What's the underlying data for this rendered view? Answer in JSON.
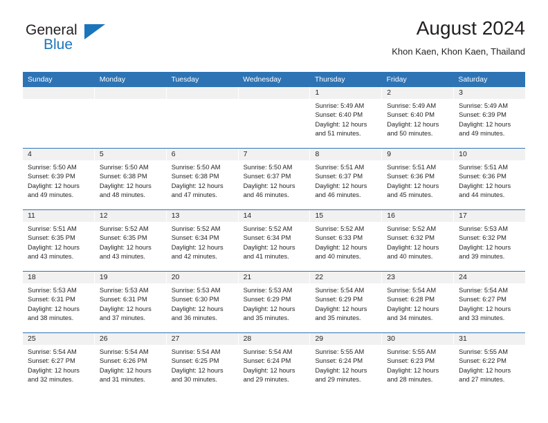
{
  "brand": {
    "line1": "General",
    "line2": "Blue",
    "triangle_icon": "triangle-icon",
    "color_dark": "#231f20",
    "color_blue": "#1b75bb"
  },
  "header": {
    "title": "August 2024",
    "subtitle": "Khon Kaen, Khon Kaen, Thailand"
  },
  "theme": {
    "header_bg": "#2e74b5",
    "day_band_bg": "#f1f1f1",
    "text": "#231f20"
  },
  "weekdays": [
    {
      "label": "Sunday"
    },
    {
      "label": "Monday"
    },
    {
      "label": "Tuesday"
    },
    {
      "label": "Wednesday"
    },
    {
      "label": "Thursday"
    },
    {
      "label": "Friday"
    },
    {
      "label": "Saturday"
    }
  ],
  "weeks": [
    {
      "days": [
        {
          "number": "",
          "sunrise": "",
          "sunset": "",
          "daylight_line1": "",
          "daylight_line2": "",
          "empty": true
        },
        {
          "number": "",
          "sunrise": "",
          "sunset": "",
          "daylight_line1": "",
          "daylight_line2": "",
          "empty": true
        },
        {
          "number": "",
          "sunrise": "",
          "sunset": "",
          "daylight_line1": "",
          "daylight_line2": "",
          "empty": true
        },
        {
          "number": "",
          "sunrise": "",
          "sunset": "",
          "daylight_line1": "",
          "daylight_line2": "",
          "empty": true
        },
        {
          "number": "1",
          "sunrise": "Sunrise: 5:49 AM",
          "sunset": "Sunset: 6:40 PM",
          "daylight_line1": "Daylight: 12 hours",
          "daylight_line2": "and 51 minutes.",
          "empty": false
        },
        {
          "number": "2",
          "sunrise": "Sunrise: 5:49 AM",
          "sunset": "Sunset: 6:40 PM",
          "daylight_line1": "Daylight: 12 hours",
          "daylight_line2": "and 50 minutes.",
          "empty": false
        },
        {
          "number": "3",
          "sunrise": "Sunrise: 5:49 AM",
          "sunset": "Sunset: 6:39 PM",
          "daylight_line1": "Daylight: 12 hours",
          "daylight_line2": "and 49 minutes.",
          "empty": false
        }
      ]
    },
    {
      "days": [
        {
          "number": "4",
          "sunrise": "Sunrise: 5:50 AM",
          "sunset": "Sunset: 6:39 PM",
          "daylight_line1": "Daylight: 12 hours",
          "daylight_line2": "and 49 minutes.",
          "empty": false
        },
        {
          "number": "5",
          "sunrise": "Sunrise: 5:50 AM",
          "sunset": "Sunset: 6:38 PM",
          "daylight_line1": "Daylight: 12 hours",
          "daylight_line2": "and 48 minutes.",
          "empty": false
        },
        {
          "number": "6",
          "sunrise": "Sunrise: 5:50 AM",
          "sunset": "Sunset: 6:38 PM",
          "daylight_line1": "Daylight: 12 hours",
          "daylight_line2": "and 47 minutes.",
          "empty": false
        },
        {
          "number": "7",
          "sunrise": "Sunrise: 5:50 AM",
          "sunset": "Sunset: 6:37 PM",
          "daylight_line1": "Daylight: 12 hours",
          "daylight_line2": "and 46 minutes.",
          "empty": false
        },
        {
          "number": "8",
          "sunrise": "Sunrise: 5:51 AM",
          "sunset": "Sunset: 6:37 PM",
          "daylight_line1": "Daylight: 12 hours",
          "daylight_line2": "and 46 minutes.",
          "empty": false
        },
        {
          "number": "9",
          "sunrise": "Sunrise: 5:51 AM",
          "sunset": "Sunset: 6:36 PM",
          "daylight_line1": "Daylight: 12 hours",
          "daylight_line2": "and 45 minutes.",
          "empty": false
        },
        {
          "number": "10",
          "sunrise": "Sunrise: 5:51 AM",
          "sunset": "Sunset: 6:36 PM",
          "daylight_line1": "Daylight: 12 hours",
          "daylight_line2": "and 44 minutes.",
          "empty": false
        }
      ]
    },
    {
      "days": [
        {
          "number": "11",
          "sunrise": "Sunrise: 5:51 AM",
          "sunset": "Sunset: 6:35 PM",
          "daylight_line1": "Daylight: 12 hours",
          "daylight_line2": "and 43 minutes.",
          "empty": false
        },
        {
          "number": "12",
          "sunrise": "Sunrise: 5:52 AM",
          "sunset": "Sunset: 6:35 PM",
          "daylight_line1": "Daylight: 12 hours",
          "daylight_line2": "and 43 minutes.",
          "empty": false
        },
        {
          "number": "13",
          "sunrise": "Sunrise: 5:52 AM",
          "sunset": "Sunset: 6:34 PM",
          "daylight_line1": "Daylight: 12 hours",
          "daylight_line2": "and 42 minutes.",
          "empty": false
        },
        {
          "number": "14",
          "sunrise": "Sunrise: 5:52 AM",
          "sunset": "Sunset: 6:34 PM",
          "daylight_line1": "Daylight: 12 hours",
          "daylight_line2": "and 41 minutes.",
          "empty": false
        },
        {
          "number": "15",
          "sunrise": "Sunrise: 5:52 AM",
          "sunset": "Sunset: 6:33 PM",
          "daylight_line1": "Daylight: 12 hours",
          "daylight_line2": "and 40 minutes.",
          "empty": false
        },
        {
          "number": "16",
          "sunrise": "Sunrise: 5:52 AM",
          "sunset": "Sunset: 6:32 PM",
          "daylight_line1": "Daylight: 12 hours",
          "daylight_line2": "and 40 minutes.",
          "empty": false
        },
        {
          "number": "17",
          "sunrise": "Sunrise: 5:53 AM",
          "sunset": "Sunset: 6:32 PM",
          "daylight_line1": "Daylight: 12 hours",
          "daylight_line2": "and 39 minutes.",
          "empty": false
        }
      ]
    },
    {
      "days": [
        {
          "number": "18",
          "sunrise": "Sunrise: 5:53 AM",
          "sunset": "Sunset: 6:31 PM",
          "daylight_line1": "Daylight: 12 hours",
          "daylight_line2": "and 38 minutes.",
          "empty": false
        },
        {
          "number": "19",
          "sunrise": "Sunrise: 5:53 AM",
          "sunset": "Sunset: 6:31 PM",
          "daylight_line1": "Daylight: 12 hours",
          "daylight_line2": "and 37 minutes.",
          "empty": false
        },
        {
          "number": "20",
          "sunrise": "Sunrise: 5:53 AM",
          "sunset": "Sunset: 6:30 PM",
          "daylight_line1": "Daylight: 12 hours",
          "daylight_line2": "and 36 minutes.",
          "empty": false
        },
        {
          "number": "21",
          "sunrise": "Sunrise: 5:53 AM",
          "sunset": "Sunset: 6:29 PM",
          "daylight_line1": "Daylight: 12 hours",
          "daylight_line2": "and 35 minutes.",
          "empty": false
        },
        {
          "number": "22",
          "sunrise": "Sunrise: 5:54 AM",
          "sunset": "Sunset: 6:29 PM",
          "daylight_line1": "Daylight: 12 hours",
          "daylight_line2": "and 35 minutes.",
          "empty": false
        },
        {
          "number": "23",
          "sunrise": "Sunrise: 5:54 AM",
          "sunset": "Sunset: 6:28 PM",
          "daylight_line1": "Daylight: 12 hours",
          "daylight_line2": "and 34 minutes.",
          "empty": false
        },
        {
          "number": "24",
          "sunrise": "Sunrise: 5:54 AM",
          "sunset": "Sunset: 6:27 PM",
          "daylight_line1": "Daylight: 12 hours",
          "daylight_line2": "and 33 minutes.",
          "empty": false
        }
      ]
    },
    {
      "days": [
        {
          "number": "25",
          "sunrise": "Sunrise: 5:54 AM",
          "sunset": "Sunset: 6:27 PM",
          "daylight_line1": "Daylight: 12 hours",
          "daylight_line2": "and 32 minutes.",
          "empty": false
        },
        {
          "number": "26",
          "sunrise": "Sunrise: 5:54 AM",
          "sunset": "Sunset: 6:26 PM",
          "daylight_line1": "Daylight: 12 hours",
          "daylight_line2": "and 31 minutes.",
          "empty": false
        },
        {
          "number": "27",
          "sunrise": "Sunrise: 5:54 AM",
          "sunset": "Sunset: 6:25 PM",
          "daylight_line1": "Daylight: 12 hours",
          "daylight_line2": "and 30 minutes.",
          "empty": false
        },
        {
          "number": "28",
          "sunrise": "Sunrise: 5:54 AM",
          "sunset": "Sunset: 6:24 PM",
          "daylight_line1": "Daylight: 12 hours",
          "daylight_line2": "and 29 minutes.",
          "empty": false
        },
        {
          "number": "29",
          "sunrise": "Sunrise: 5:55 AM",
          "sunset": "Sunset: 6:24 PM",
          "daylight_line1": "Daylight: 12 hours",
          "daylight_line2": "and 29 minutes.",
          "empty": false
        },
        {
          "number": "30",
          "sunrise": "Sunrise: 5:55 AM",
          "sunset": "Sunset: 6:23 PM",
          "daylight_line1": "Daylight: 12 hours",
          "daylight_line2": "and 28 minutes.",
          "empty": false
        },
        {
          "number": "31",
          "sunrise": "Sunrise: 5:55 AM",
          "sunset": "Sunset: 6:22 PM",
          "daylight_line1": "Daylight: 12 hours",
          "daylight_line2": "and 27 minutes.",
          "empty": false
        }
      ]
    }
  ]
}
